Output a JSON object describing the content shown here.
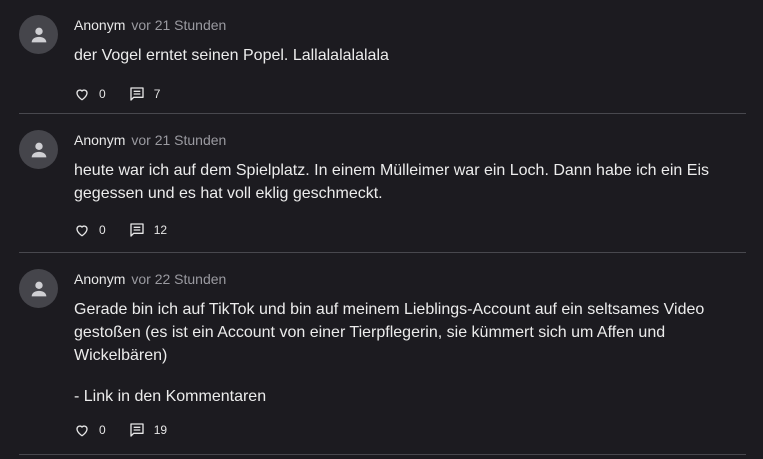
{
  "comments": [
    {
      "author": "Anonym",
      "time": "vor 21 Stunden",
      "paragraphs": [
        "der Vogel erntet seinen Popel. Lallalalalalala"
      ],
      "likes": "0",
      "replies": "7"
    },
    {
      "author": "Anonym",
      "time": "vor 21 Stunden",
      "paragraphs": [
        "heute war ich auf dem Spielplatz. In einem Mülleimer war ein Loch. Dann habe ich ein Eis gegessen und es hat voll eklig geschmeckt."
      ],
      "likes": "0",
      "replies": "12"
    },
    {
      "author": "Anonym",
      "time": "vor 22 Stunden",
      "paragraphs": [
        "Gerade bin ich auf TikTok und bin auf meinem Lieblings-Account auf ein seltsames Video gestoßen (es ist ein Account von einer Tierpflegerin, sie kümmert sich um Affen und Wickelbären)",
        "- Link in den Kommentaren"
      ],
      "likes": "0",
      "replies": "19"
    }
  ],
  "icons": {
    "avatar": "user-icon",
    "like": "heart-outline-icon",
    "reply": "comment-icon"
  },
  "colors": {
    "background": "#1c1b20",
    "avatar_bg": "#45454b",
    "divider": "#48484e",
    "timestamp": "#9a9aa0"
  }
}
